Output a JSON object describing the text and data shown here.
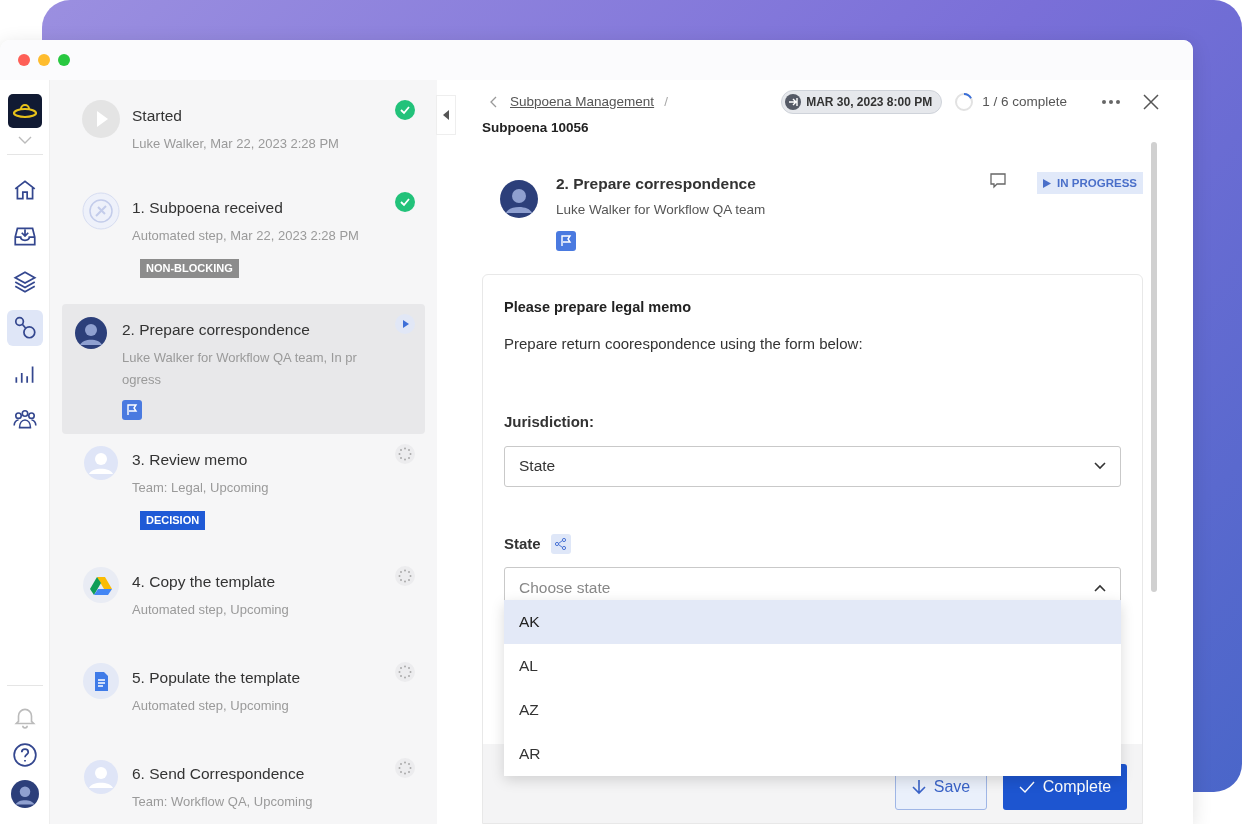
{
  "rail": {
    "items": [
      {
        "kind": "home",
        "selected": false
      },
      {
        "kind": "inbox",
        "selected": false
      },
      {
        "kind": "layers",
        "selected": false
      },
      {
        "kind": "workflow",
        "selected": true
      },
      {
        "kind": "chart",
        "selected": false
      },
      {
        "kind": "people",
        "selected": false
      }
    ],
    "bottom": [
      {
        "kind": "bell"
      },
      {
        "kind": "help"
      },
      {
        "kind": "avatar"
      }
    ]
  },
  "steps": [
    {
      "kind": "play",
      "title": "Started",
      "subtitle": "Luke Walker, Mar 22, 2023 2:28 PM",
      "completed": true,
      "in_progress": false,
      "selected": false
    },
    {
      "kind": "automation",
      "title": "1. Subpoena received",
      "subtitle": "Automated step, Mar 22, 2023 2:28 PM",
      "completed": true,
      "in_progress": false,
      "selected": false,
      "badge": {
        "text": "NON-BLOCKING",
        "color": "#8c8c8c"
      }
    },
    {
      "kind": "avatar",
      "title": "2. Prepare correspondence",
      "subtitle": "Luke Walker for Workflow QA team, In progress",
      "completed": false,
      "in_progress": true,
      "selected": true,
      "flag": true
    },
    {
      "kind": "team",
      "title": "3. Review memo",
      "subtitle": "Team: Legal, Upcoming",
      "completed": false,
      "in_progress": false,
      "selected": false,
      "badge": {
        "text": "DECISION",
        "color": "#1f5ad6"
      }
    },
    {
      "kind": "drive",
      "title": "4. Copy the template",
      "subtitle": "Automated step, Upcoming",
      "completed": false,
      "in_progress": false,
      "selected": false
    },
    {
      "kind": "doc",
      "title": "5. Populate the template",
      "subtitle": "Automated step, Upcoming",
      "completed": false,
      "in_progress": false,
      "selected": false
    },
    {
      "kind": "team",
      "title": "6. Send Correspondence",
      "subtitle": "Team: Workflow QA, Upcoming",
      "completed": false,
      "in_progress": false,
      "selected": false
    }
  ],
  "header": {
    "breadcrumb": "Subpoena Management",
    "separator": "/",
    "title": "Subpoena 10056",
    "due": "MAR 30, 2023 8:00 PM",
    "progress": {
      "text": "1 / 6 complete"
    }
  },
  "task": {
    "title": "2. Prepare correspondence",
    "assignee": "Luke Walker for Workflow QA team",
    "flag": true,
    "status": "IN PROGRESS"
  },
  "form": {
    "heading": "Please prepare legal memo",
    "instruction": "Prepare return coorespondence using the form below:",
    "fields": [
      {
        "label": "Jurisdiction:",
        "value": "State",
        "expanded": false
      },
      {
        "label": "State",
        "placeholder": "Choose state",
        "shared": true,
        "expanded": true,
        "options": [
          {
            "label": "AK",
            "selected": true
          },
          {
            "label": "AL",
            "selected": false
          },
          {
            "label": "AZ",
            "selected": false
          },
          {
            "label": "AR",
            "selected": false
          }
        ]
      }
    ],
    "buttons": [
      {
        "kind": "save",
        "label": "Save"
      },
      {
        "kind": "complete",
        "label": "Complete"
      }
    ]
  }
}
